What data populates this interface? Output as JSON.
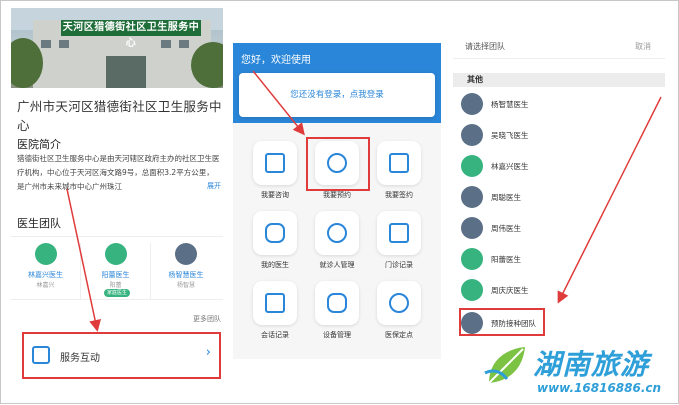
{
  "left": {
    "sign_text": "天河区猎德街社区卫生服务中心",
    "name": "广州市天河区猎德街社区卫生服务中心",
    "intro_title": "医院简介",
    "intro_text": "猎德街社区卫生服务中心是由天河辖区政府主办的社区卫生医疗机构，中心位于天河区海文路9号，总面积3.2平方公里，是广州市未来城市中心广州珠江",
    "expand": "展开",
    "team_title": "医生团队",
    "members": [
      {
        "name": "林嘉兴医生",
        "sub": "林嘉兴",
        "tag": ""
      },
      {
        "name": "阳蕾医生",
        "sub": "阳蕾",
        "tag": "家庭医生"
      },
      {
        "name": "杨智慧医生",
        "sub": "杨智慧",
        "tag": ""
      }
    ],
    "more": "更多团队",
    "service": "服务互动",
    "chevron": "›"
  },
  "middle": {
    "greeting": "您好，欢迎使用",
    "login_prompt": "您还没有登录，点我登录",
    "tiles": [
      {
        "label": "我要咨询",
        "icon": "consult-icon"
      },
      {
        "label": "我要预约",
        "icon": "appointment-icon"
      },
      {
        "label": "我要签约",
        "icon": "sign-contract-icon"
      },
      {
        "label": "我的医生",
        "icon": "my-doctor-icon"
      },
      {
        "label": "就诊人管理",
        "icon": "patient-management-icon"
      },
      {
        "label": "门诊记录",
        "icon": "clinic-record-icon"
      },
      {
        "label": "会话记录",
        "icon": "chat-record-icon"
      },
      {
        "label": "设备管理",
        "icon": "device-management-icon"
      },
      {
        "label": "医保定点",
        "icon": "insurance-point-icon"
      }
    ]
  },
  "right": {
    "title": "请选择团队",
    "cancel": "取消",
    "group": "其他",
    "doctors": [
      "杨智慧医生",
      "吴晓飞医生",
      "林嘉兴医生",
      "周聪医生",
      "周伟医生",
      "阳蕾医生",
      "周庆庆医生",
      "预防接种团队"
    ]
  },
  "watermark": {
    "brand": "湖南旅游",
    "url": "www.16816886.cn"
  },
  "colors": {
    "primary": "#2a86d8",
    "green": "#36b37e",
    "highlight": "#e03b3b"
  }
}
